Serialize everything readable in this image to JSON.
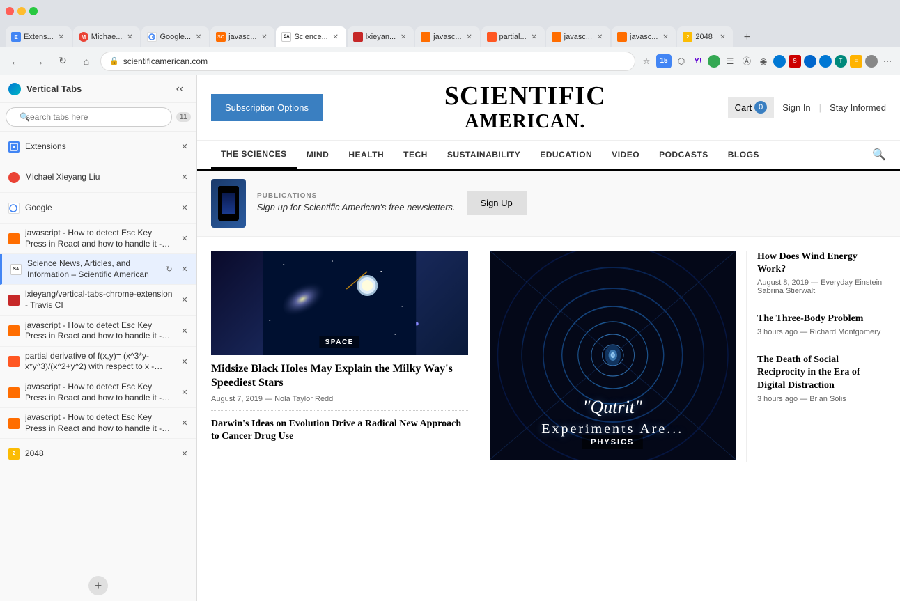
{
  "browser": {
    "tabs": [
      {
        "id": "ext",
        "label": "Extens...",
        "favicon_color": "#4285f4",
        "favicon_text": "E",
        "active": false
      },
      {
        "id": "michael",
        "label": "Michae...",
        "favicon_color": "#ea4335",
        "favicon_text": "M",
        "active": false
      },
      {
        "id": "google",
        "label": "Google...",
        "favicon_color": "#4285f4",
        "favicon_text": "G",
        "active": false
      },
      {
        "id": "js1",
        "label": "javasc...",
        "favicon_color": "#ff6d00",
        "favicon_text": "J",
        "active": false
      },
      {
        "id": "sa",
        "label": "Science...",
        "favicon_color": "#000",
        "favicon_text": "SA",
        "active": true
      },
      {
        "id": "lxieyang",
        "label": "lxieyan...",
        "favicon_color": "#34a853",
        "favicon_text": "L",
        "active": false
      },
      {
        "id": "js2",
        "label": "javasc...",
        "favicon_color": "#ff6d00",
        "favicon_text": "J",
        "active": false
      },
      {
        "id": "partial",
        "label": "partial...",
        "favicon_color": "#ff6d00",
        "favicon_text": "P",
        "active": false
      },
      {
        "id": "js3",
        "label": "javasc...",
        "favicon_color": "#ff6d00",
        "favicon_text": "J",
        "active": false
      },
      {
        "id": "js4",
        "label": "javasc...",
        "favicon_color": "#ff6d00",
        "favicon_text": "J",
        "active": false
      },
      {
        "id": "2048",
        "label": "2048",
        "favicon_color": "#fbbc04",
        "favicon_text": "2",
        "active": false
      }
    ],
    "url": "scientificamerican.com",
    "new_tab_label": "+"
  },
  "sidebar": {
    "title": "Vertical Tabs",
    "search_placeholder": "search tabs here",
    "tab_count": "11",
    "tabs": [
      {
        "id": "ext",
        "title": "Extensions",
        "favicon_color": "#4285f4",
        "favicon_text": "E",
        "active": false
      },
      {
        "id": "michael",
        "title": "Michael Xieyang Liu",
        "favicon_color": "#ea4335",
        "favicon_text": "M",
        "active": false
      },
      {
        "id": "google",
        "title": "Google",
        "favicon_color": "#4285f4",
        "favicon_text": "G",
        "active": false
      },
      {
        "id": "js1",
        "title": "javascript - How to detect Esc Key Press in React and how to handle it - Stack Overflow",
        "favicon_color": "#ff6d00",
        "favicon_text": "J",
        "active": false
      },
      {
        "id": "sa",
        "title": "Science News, Articles, and Information – Scientific American",
        "favicon_color": "#000",
        "favicon_text": "SA",
        "active": true
      },
      {
        "id": "lxieyang",
        "title": "lxieyang/vertical-tabs-chrome-extension - Travis CI",
        "favicon_color": "#c62828",
        "favicon_text": "T",
        "active": false
      },
      {
        "id": "js2",
        "title": "javascript - How to detect Esc Key Press in React and how to handle it - Stack Overflow",
        "favicon_color": "#ff6d00",
        "favicon_text": "J",
        "active": false
      },
      {
        "id": "partial",
        "title": "partial derivative of f(x,y)= (x^3*y-x*y^3)/(x^2+y^2) with respect to x - Wolfram|Alpha",
        "favicon_color": "#ff6d00",
        "favicon_text": "W",
        "active": false
      },
      {
        "id": "js3",
        "title": "javascript - How to detect Esc Key Press in React and how to handle it - Stack Overflow",
        "favicon_color": "#ff6d00",
        "favicon_text": "J",
        "active": false
      },
      {
        "id": "js4",
        "title": "javascript - How to detect Esc Key Press in React and how to handle it - Stack Overflow",
        "favicon_color": "#ff6d00",
        "favicon_text": "J",
        "active": false
      },
      {
        "id": "2048",
        "title": "2048",
        "favicon_color": "#fbbc04",
        "favicon_text": "2",
        "active": false
      }
    ],
    "add_tab_label": "+"
  },
  "page": {
    "header": {
      "subscribe_btn": "Subscription Options",
      "logo_line1": "SCIENTIFIC",
      "logo_line2": "AMERICAN.",
      "cart_label": "Cart",
      "cart_count": "0",
      "sign_in": "Sign In",
      "divider": "|",
      "stay_informed": "Stay Informed"
    },
    "nav": {
      "items": [
        "THE SCIENCES",
        "MIND",
        "HEALTH",
        "TECH",
        "SUSTAINABILITY",
        "EDUCATION",
        "VIDEO",
        "PODCASTS",
        "BLOGS"
      ]
    },
    "newsletter": {
      "label": "PUBLICATIONS",
      "text": "Sign up for Scientific American's free newsletters.",
      "button": "Sign Up"
    },
    "articles": {
      "left": {
        "tag": "SPACE",
        "title": "Midsize Black Holes May Explain the Milky Way's Speediest Stars",
        "meta": "August 7, 2019 — Nola Taylor Redd",
        "divider": true,
        "bottom_title": "Darwin's Ideas on Evolution Drive a Radical New Approach to Cancer Drug Use",
        "bottom_meta": ""
      },
      "center": {
        "tag": "PHYSICS",
        "qutrit": "\"Qutrit\"",
        "experiments": "Experiments Are..."
      },
      "right_articles": [
        {
          "title": "How Does Wind Energy Work?",
          "meta": "August 8, 2019 — Everyday Einstein Sabrina Stierwalt"
        },
        {
          "title": "The Three-Body Problem",
          "meta": "3 hours ago — Richard Montgomery"
        },
        {
          "title": "The Death of Social Reciprocity in the Era of Digital Distraction",
          "meta": "3 hours ago — Brian Solis"
        }
      ]
    }
  }
}
